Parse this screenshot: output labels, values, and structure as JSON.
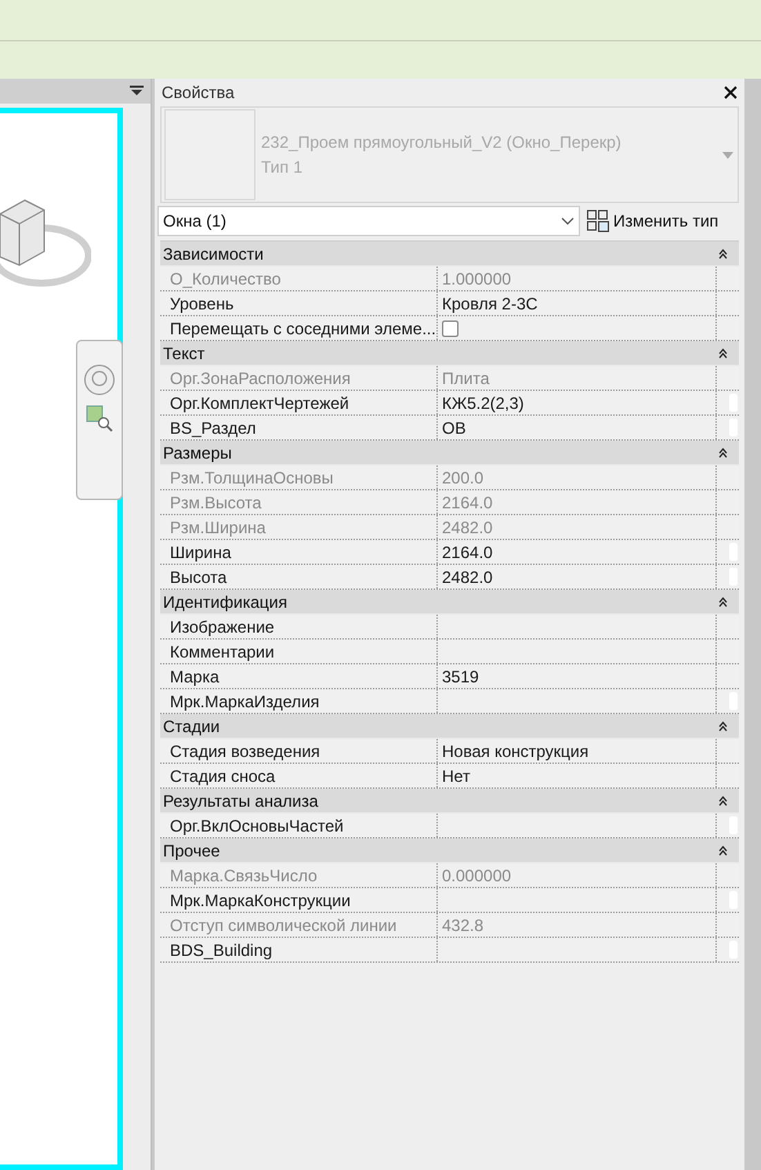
{
  "properties_panel": {
    "title": "Свойства",
    "type_selector": {
      "family": "232_Проем прямоугольный_V2 (Окно_Перекр)",
      "type": "Тип 1"
    },
    "category_dropdown": "Окна (1)",
    "edit_type_button": "Изменить тип",
    "groups": [
      {
        "name": "Зависимости",
        "expanded": true,
        "rows": [
          {
            "kind": "text",
            "label": "О_Количество",
            "value": "1.000000",
            "disabled": true,
            "link_button": false
          },
          {
            "kind": "text",
            "label": "Уровень",
            "value": "Кровля 2-3С",
            "disabled": false,
            "link_button": false
          },
          {
            "kind": "checkbox",
            "label": "Перемещать с соседними элеме...",
            "checked": false,
            "disabled": false,
            "link_button": false
          }
        ]
      },
      {
        "name": "Текст",
        "expanded": true,
        "rows": [
          {
            "kind": "text",
            "label": "Орг.ЗонаРасположения",
            "value": "Плита",
            "disabled": true,
            "link_button": false
          },
          {
            "kind": "text",
            "label": "Орг.КомплектЧертежей",
            "value": "КЖ5.2(2,3)",
            "disabled": false,
            "link_button": true
          },
          {
            "kind": "text",
            "label": "BS_Раздел",
            "value": "ОВ",
            "disabled": false,
            "link_button": true
          }
        ]
      },
      {
        "name": "Размеры",
        "expanded": true,
        "rows": [
          {
            "kind": "text",
            "label": "Рзм.ТолщинаОсновы",
            "value": "200.0",
            "disabled": true,
            "link_button": false
          },
          {
            "kind": "text",
            "label": "Рзм.Высота",
            "value": "2164.0",
            "disabled": true,
            "link_button": false
          },
          {
            "kind": "text",
            "label": "Рзм.Ширина",
            "value": "2482.0",
            "disabled": true,
            "link_button": false
          },
          {
            "kind": "text",
            "label": "Ширина",
            "value": "2164.0",
            "disabled": false,
            "link_button": true
          },
          {
            "kind": "text",
            "label": "Высота",
            "value": "2482.0",
            "disabled": false,
            "link_button": true
          }
        ]
      },
      {
        "name": "Идентификация",
        "expanded": true,
        "rows": [
          {
            "kind": "text",
            "label": "Изображение",
            "disabled": false,
            "link_button": false
          },
          {
            "kind": "text",
            "label": "Комментарии",
            "disabled": false,
            "link_button": false
          },
          {
            "kind": "text",
            "label": "Марка",
            "value": "3519",
            "disabled": false,
            "link_button": false
          },
          {
            "kind": "text",
            "label": "Мрк.МаркаИзделия",
            "disabled": false,
            "link_button": true
          }
        ]
      },
      {
        "name": "Стадии",
        "expanded": true,
        "rows": [
          {
            "kind": "text",
            "label": "Стадия возведения",
            "value": "Новая конструкция",
            "disabled": false,
            "link_button": false
          },
          {
            "kind": "text",
            "label": "Стадия сноса",
            "value": "Нет",
            "disabled": false,
            "link_button": false
          }
        ]
      },
      {
        "name": "Результаты анализа",
        "expanded": true,
        "rows": [
          {
            "kind": "text",
            "label": "Орг.ВклОсновыЧастей",
            "disabled": false,
            "link_button": true
          }
        ]
      },
      {
        "name": "Прочее",
        "expanded": true,
        "rows": [
          {
            "kind": "text",
            "label": "Марка.СвязьЧисло",
            "value": "0.000000",
            "disabled": true,
            "link_button": false
          },
          {
            "kind": "text",
            "label": "Мрк.МаркаКонструкции",
            "disabled": false,
            "link_button": true
          },
          {
            "kind": "text",
            "label": "Отступ символической линии",
            "value": "432.8",
            "disabled": true,
            "link_button": false
          },
          {
            "kind": "text",
            "label": "BDS_Building",
            "disabled": false,
            "link_button": true
          }
        ]
      }
    ]
  }
}
